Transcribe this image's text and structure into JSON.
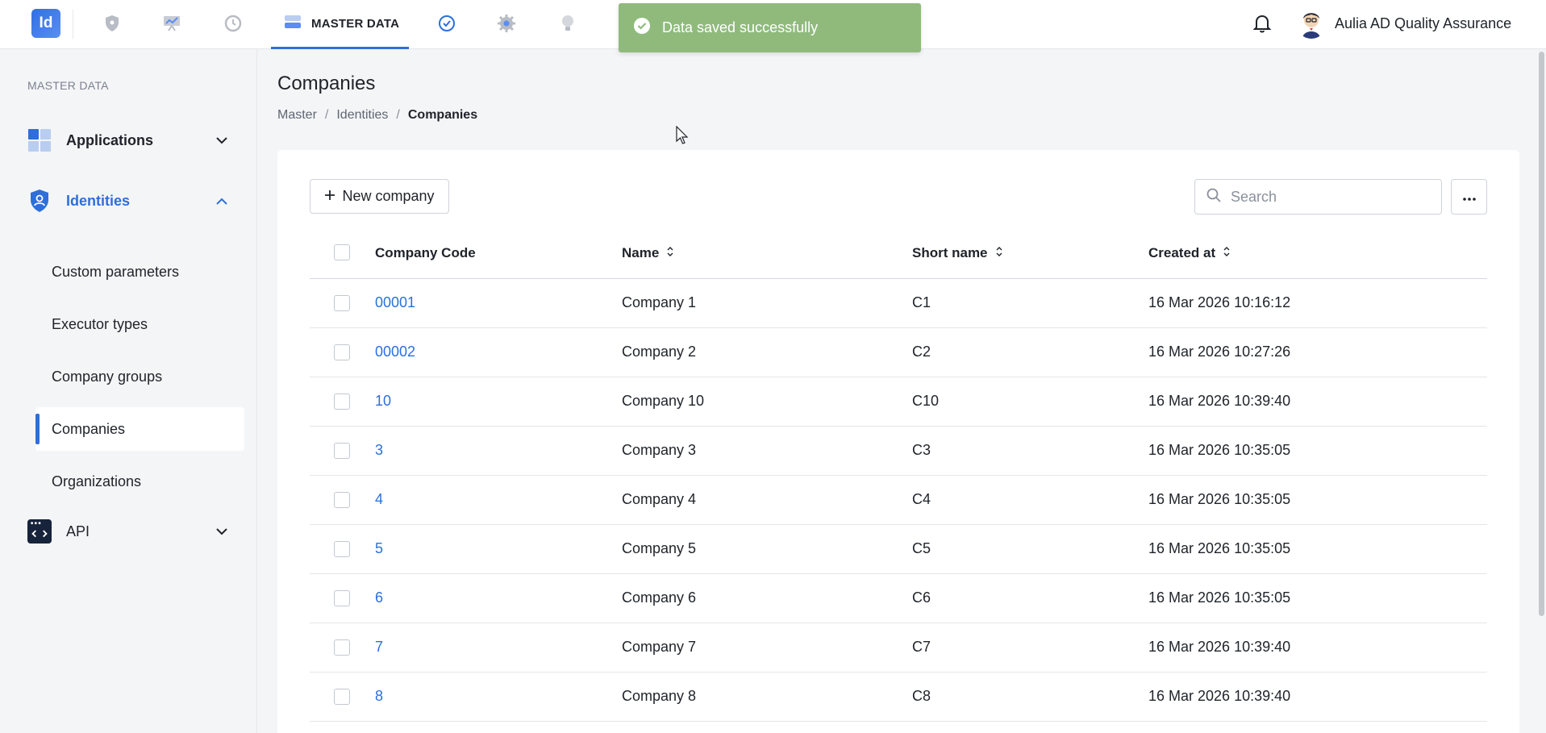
{
  "header": {
    "logo_text": "Id",
    "active_tab": "MASTER DATA",
    "nav_icons": [
      "shield-icon",
      "dashboard-icon",
      "history-icon",
      "master-data-icon",
      "check-badge-icon",
      "gear-icon",
      "bulb-icon"
    ],
    "toast_message": "Data saved successfully",
    "username": "Aulia AD Quality Assurance"
  },
  "sidebar": {
    "heading": "MASTER DATA",
    "groups": [
      {
        "label": "Applications"
      },
      {
        "label": "Identities"
      },
      {
        "label": "API"
      }
    ],
    "identities_items": [
      {
        "label": "Custom parameters"
      },
      {
        "label": "Executor types"
      },
      {
        "label": "Company groups"
      },
      {
        "label": "Companies"
      },
      {
        "label": "Organizations"
      }
    ]
  },
  "page": {
    "title": "Companies",
    "breadcrumb": [
      "Master",
      "Identities",
      "Companies"
    ]
  },
  "toolbar": {
    "new_label": "New company",
    "search_placeholder": "Search"
  },
  "table": {
    "columns": [
      "Company Code",
      "Name",
      "Short name",
      "Created at"
    ],
    "rows": [
      {
        "code": "00001",
        "name": "Company 1",
        "short": "C1",
        "created": "16 Mar 2026 10:16:12"
      },
      {
        "code": "00002",
        "name": "Company 2",
        "short": "C2",
        "created": "16 Mar 2026 10:27:26"
      },
      {
        "code": "10",
        "name": "Company 10",
        "short": "C10",
        "created": "16 Mar 2026 10:39:40"
      },
      {
        "code": "3",
        "name": "Company 3",
        "short": "C3",
        "created": "16 Mar 2026 10:35:05"
      },
      {
        "code": "4",
        "name": "Company 4",
        "short": "C4",
        "created": "16 Mar 2026 10:35:05"
      },
      {
        "code": "5",
        "name": "Company 5",
        "short": "C5",
        "created": "16 Mar 2026 10:35:05"
      },
      {
        "code": "6",
        "name": "Company 6",
        "short": "C6",
        "created": "16 Mar 2026 10:35:05"
      },
      {
        "code": "7",
        "name": "Company 7",
        "short": "C7",
        "created": "16 Mar 2026 10:39:40"
      },
      {
        "code": "8",
        "name": "Company 8",
        "short": "C8",
        "created": "16 Mar 2026 10:39:40"
      }
    ]
  },
  "colors": {
    "accent": "#2e6fd9",
    "toast": "#8fba7c"
  }
}
